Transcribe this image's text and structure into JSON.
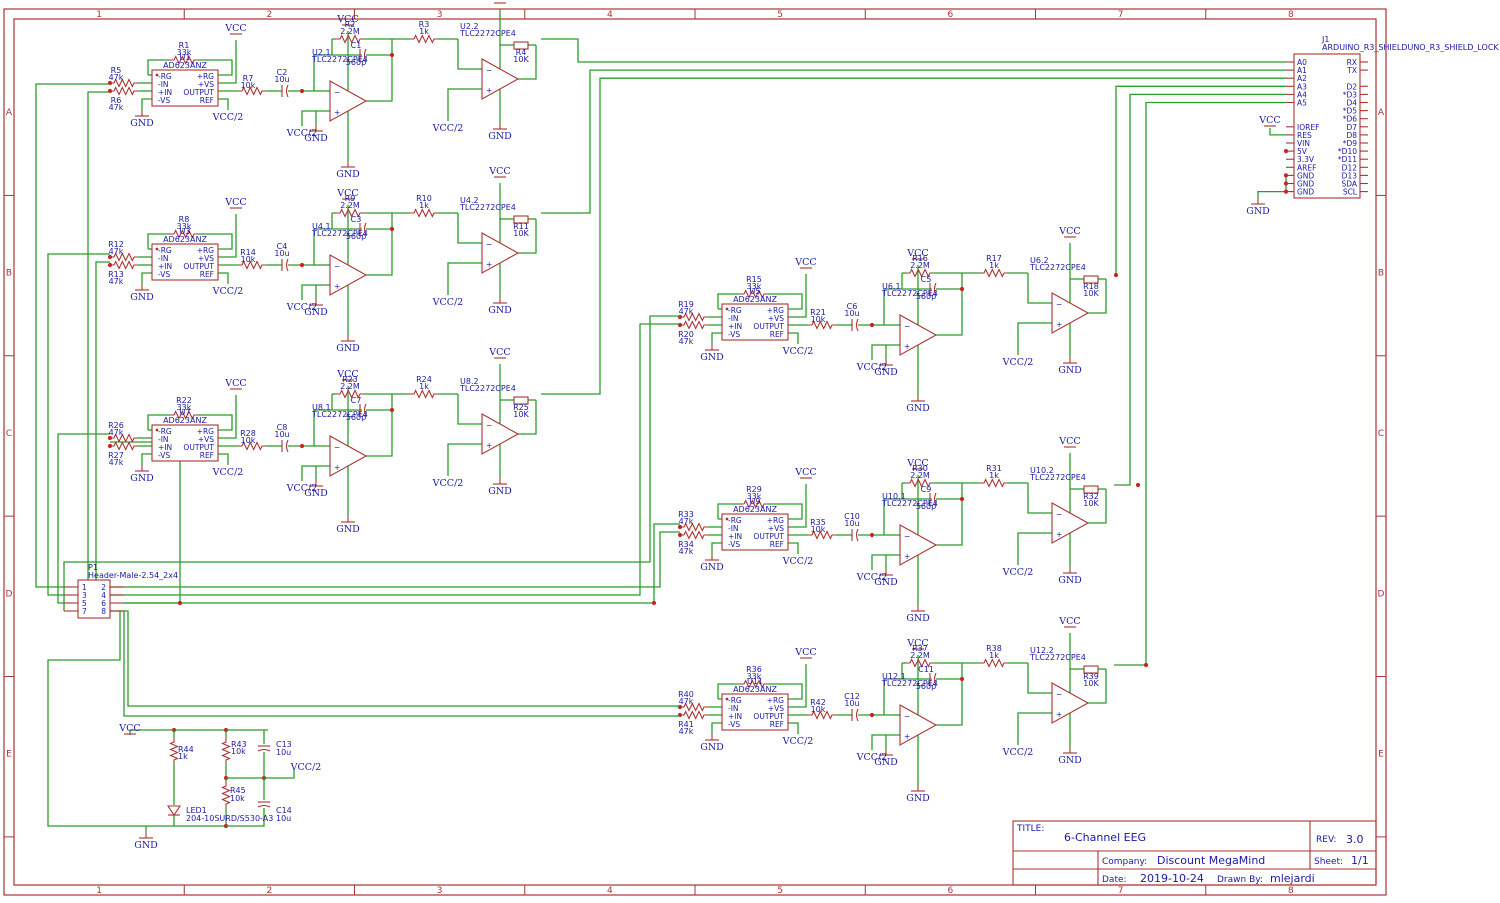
{
  "frame": {
    "columns": [
      "1",
      "2",
      "3",
      "4",
      "5",
      "6",
      "7",
      "8"
    ],
    "rows": [
      "A",
      "B",
      "C",
      "D",
      "E"
    ]
  },
  "title_block": {
    "title_label": "TITLE:",
    "title": "6-Channel EEG",
    "rev_label": "REV:",
    "rev": "3.0",
    "company_label": "Company:",
    "company": "Discount MegaMind",
    "sheet_label": "Sheet:",
    "sheet": "1/1",
    "date_label": "Date:",
    "date": "2019-10-24",
    "drawn_by_label": "Drawn By:",
    "drawn_by": "mlejardi"
  },
  "power": {
    "vcc": "VCC",
    "gnd": "GND",
    "half": "VCC/2"
  },
  "inamp_pins": {
    "left": [
      "-RG",
      "-IN",
      "+IN",
      "-VS"
    ],
    "right": [
      "+RG",
      "+VS",
      "OUTPUT",
      "REF"
    ],
    "part": "AD623ANZ"
  },
  "opamp_part": "TLC2272CPE4",
  "channels": [
    {
      "u_inamp": "U1",
      "rg": "R1",
      "rg_val": "33k",
      "rin1": "R5",
      "rin2": "R6",
      "rin_val": "47k",
      "rout": "R7",
      "rout_val": "10k",
      "c_in": "C2",
      "c_in_val": "10u",
      "u_a": "U2.1",
      "rf": "R2",
      "rf_val": "2.2M",
      "cf": "C1",
      "cf_val": "560p",
      "rs": "R3",
      "rs_val": "1k",
      "u_b": "U2.2",
      "pot": "R4",
      "pot_val": "10K"
    },
    {
      "u_inamp": "U3",
      "rg": "R8",
      "rg_val": "33k",
      "rin1": "R12",
      "rin2": "R13",
      "rin_val": "47k",
      "rout": "R14",
      "rout_val": "10k",
      "c_in": "C4",
      "c_in_val": "10u",
      "u_a": "U4.1",
      "rf": "R9",
      "rf_val": "2.2M",
      "cf": "C3",
      "cf_val": "560p",
      "rs": "R10",
      "rs_val": "1k",
      "u_b": "U4.2",
      "pot": "R11",
      "pot_val": "10K"
    },
    {
      "u_inamp": "U7",
      "rg": "R22",
      "rg_val": "33k",
      "rin1": "R26",
      "rin2": "R27",
      "rin_val": "47k",
      "rout": "R28",
      "rout_val": "10k",
      "c_in": "C8",
      "c_in_val": "10u",
      "u_a": "U8.1",
      "rf": "R23",
      "rf_val": "2.2M",
      "cf": "C7",
      "cf_val": "560p",
      "rs": "R24",
      "rs_val": "1k",
      "u_b": "U8.2",
      "pot": "R25",
      "pot_val": "10K"
    },
    {
      "u_inamp": "U5",
      "rg": "R15",
      "rg_val": "33k",
      "rin1": "R19",
      "rin2": "R20",
      "rin_val": "47k",
      "rout": "R21",
      "rout_val": "10k",
      "c_in": "C6",
      "c_in_val": "10u",
      "u_a": "U6.1",
      "rf": "R16",
      "rf_val": "2.2M",
      "cf": "C5",
      "cf_val": "560p",
      "rs": "R17",
      "rs_val": "1k",
      "u_b": "U6.2",
      "pot": "R18",
      "pot_val": "10K"
    },
    {
      "u_inamp": "U9",
      "rg": "R29",
      "rg_val": "33k",
      "rin1": "R33",
      "rin2": "R34",
      "rin_val": "47k",
      "rout": "R35",
      "rout_val": "10k",
      "c_in": "C10",
      "c_in_val": "10u",
      "u_a": "U10.1",
      "rf": "R30",
      "rf_val": "2.2M",
      "cf": "C9",
      "cf_val": "560p",
      "rs": "R31",
      "rs_val": "1k",
      "u_b": "U10.2",
      "pot": "R32",
      "pot_val": "10K"
    },
    {
      "u_inamp": "U11",
      "rg": "R36",
      "rg_val": "33k",
      "rin1": "R40",
      "rin2": "R41",
      "rin_val": "47k",
      "rout": "R42",
      "rout_val": "10k",
      "c_in": "C12",
      "c_in_val": "10u",
      "u_a": "U12.1",
      "rf": "R37",
      "rf_val": "2.2M",
      "cf": "C11",
      "cf_val": "560p",
      "rs": "R38",
      "rs_val": "1k",
      "u_b": "U12.2",
      "pot": "R39",
      "pot_val": "10K"
    }
  ],
  "arduino": {
    "ref": "J1",
    "name": "ARDUINO_R3_SHIELDUNO_R3_SHIELD_LOCK",
    "left_pins": [
      "A0",
      "A1",
      "A2",
      "A3",
      "A4",
      "A5",
      "",
      "",
      "IOREF",
      "RES",
      "VIN",
      "5V",
      "3.3V",
      "AREF",
      "GND",
      "GND",
      "GND"
    ],
    "right_pins": [
      "RX",
      "TX",
      "",
      "D2",
      "*D3",
      "D4",
      "*D5",
      "*D6",
      "D7",
      "D8",
      "*D9",
      "*D10",
      "*D11",
      "D12",
      "D13",
      "SDA",
      "SCL"
    ]
  },
  "header": {
    "ref": "P1",
    "name": "Header-Male-2.54_2x4",
    "left_pins": [
      "1",
      "3",
      "5",
      "7"
    ],
    "right_pins": [
      "2",
      "4",
      "6",
      "8"
    ]
  },
  "bias": {
    "r44": "R44",
    "r44_val": "1k",
    "r43": "R43",
    "r43_val": "10k",
    "r45": "R45",
    "r45_val": "10k",
    "c13": "C13",
    "c13_val": "10u",
    "c14": "C14",
    "c14_val": "10u",
    "led": "LED1",
    "led_val": "204-10SURD/S530-A3"
  }
}
